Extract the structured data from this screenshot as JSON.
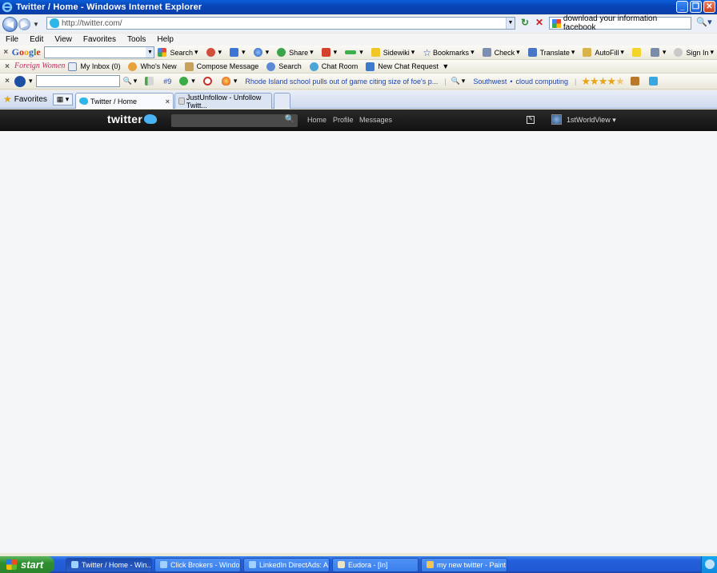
{
  "window": {
    "title": "Twitter / Home - Windows Internet Explorer"
  },
  "address_bar": {
    "url": "http://twitter.com/",
    "search_value": "download your information facebook"
  },
  "menu": [
    "File",
    "Edit",
    "View",
    "Favorites",
    "Tools",
    "Help"
  ],
  "google_toolbar": {
    "logo": "Google",
    "search_label": "Search",
    "share_label": "Share",
    "sidewiki_label": "Sidewiki",
    "bookmarks_label": "Bookmarks",
    "check_label": "Check",
    "translate_label": "Translate",
    "autofill_label": "AutoFill",
    "signin_label": "Sign In"
  },
  "foreign_women_toolbar": {
    "logo": "Foreign Women",
    "inbox_label": "My Inbox (0)",
    "whos_new_label": "Who's New",
    "compose_label": "Compose Message",
    "search_label": "Search",
    "chat_room_label": "Chat Room",
    "chat_request_label": "New Chat Request"
  },
  "ask_toolbar": {
    "rank_label": "#9",
    "news_headline": "Rhode Island school pulls out of game citing size of foe's p...",
    "link_southwest": "Southwest",
    "link_cloud": "cloud computing",
    "rating_stars": 4.5
  },
  "tabs": {
    "favorites_label": "Favorites",
    "active_tab": "Twitter / Home",
    "other_tab": "JustUnfollow - Unfollow Twitt..."
  },
  "twitter": {
    "logo": "twitter",
    "nav_home": "Home",
    "nav_profile": "Profile",
    "nav_messages": "Messages",
    "username": "1stWorldView"
  },
  "taskbar": {
    "start_label": "start",
    "tasks": [
      "Twitter / Home - Win...",
      "Click Brokers - Windo...",
      "LinkedIn DirectAds: A...",
      "Eudora - [In]",
      "my new twitter - Paint"
    ]
  },
  "colors": {
    "title_bar": "#0a50c8",
    "twitter_bar": "#1a1a1a",
    "content_bg": "#f5f6f7",
    "taskbar": "#245edb",
    "start_button": "#2f8f2f"
  }
}
